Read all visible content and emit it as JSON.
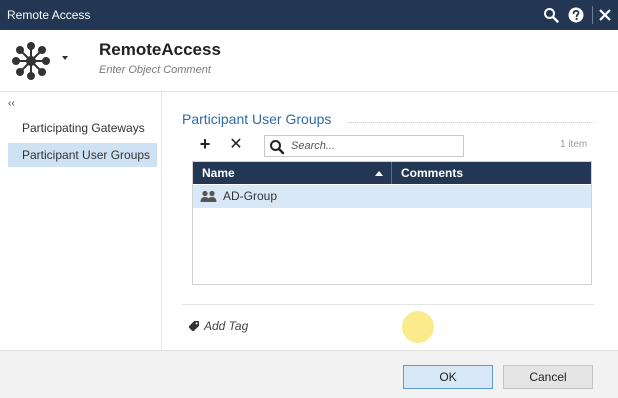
{
  "window": {
    "title": "Remote Access",
    "title_icons": [
      "search-icon",
      "help-icon",
      "close-icon"
    ]
  },
  "header": {
    "object_icon": "mesh-network-icon",
    "object_name": "RemoteAccess",
    "object_comment_placeholder": "Enter Object Comment"
  },
  "sidebar": {
    "collapse_glyph": "‹‹",
    "items": [
      {
        "label": "Participating Gateways",
        "selected": false
      },
      {
        "label": "Participant User Groups",
        "selected": true
      }
    ]
  },
  "main": {
    "section_title": "Participant User Groups",
    "toolbar": {
      "add_icon": "plus-icon",
      "remove_icon": "close-icon",
      "add_glyph": "+",
      "remove_glyph": "✕"
    },
    "search": {
      "placeholder": "Search...",
      "value": ""
    },
    "item_count": "1 item",
    "grid": {
      "columns": [
        "Name",
        "Comments"
      ],
      "sort": {
        "column": "Name",
        "direction": "ascending"
      },
      "rows": [
        {
          "icon": "user-group-icon",
          "name": "AD-Group",
          "comments": "",
          "selected": true
        }
      ]
    },
    "add_tag_label": "Add Tag"
  },
  "footer": {
    "ok_label": "OK",
    "cancel_label": "Cancel"
  },
  "colors": {
    "titlebar": "#233653",
    "accent": "#2f6aa5",
    "selected_row": "#d9e8f6",
    "selected_nav": "#cfe2f3"
  }
}
